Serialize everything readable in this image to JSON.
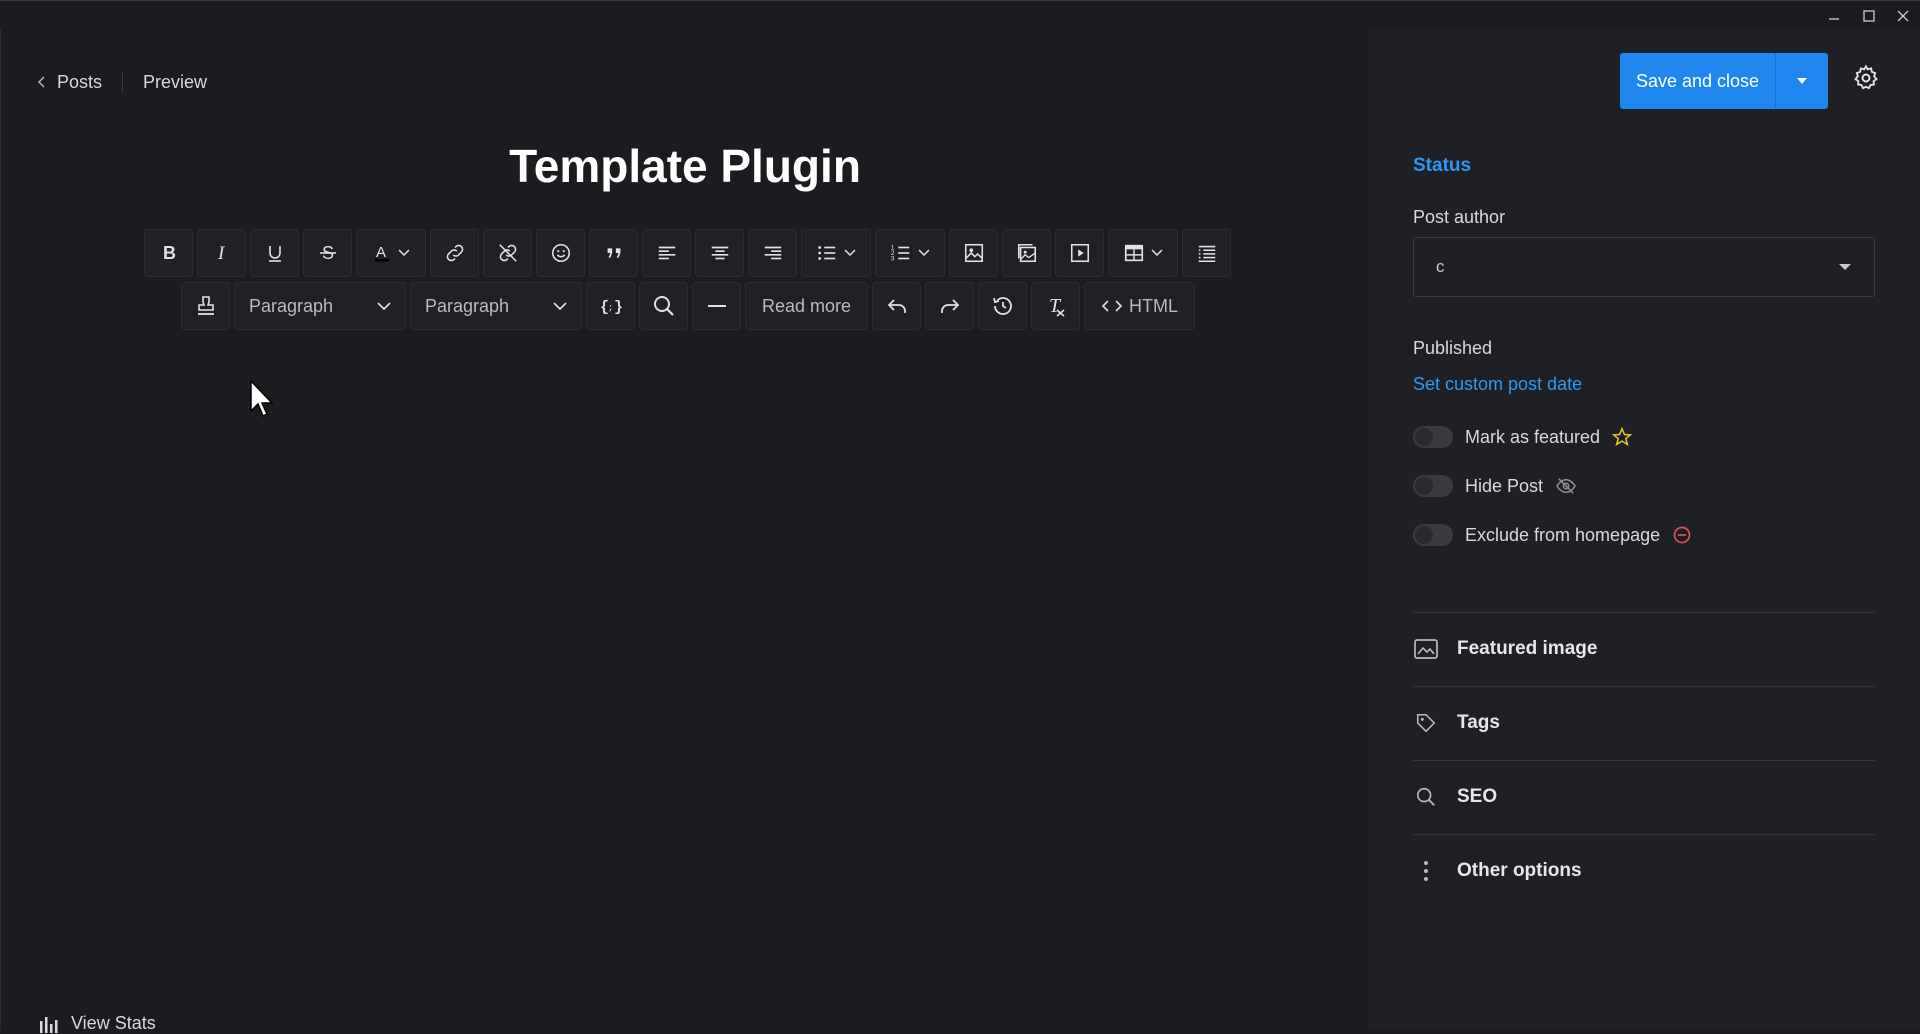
{
  "window": {
    "minimize": "minimize",
    "maximize": "maximize",
    "close": "close"
  },
  "breadcrumb": {
    "back_label": "Posts",
    "preview_label": "Preview"
  },
  "post": {
    "title": "Template Plugin"
  },
  "toolbar": {
    "row1": [
      {
        "name": "bold-button",
        "icon": "bold-icon"
      },
      {
        "name": "italic-button",
        "icon": "italic-icon"
      },
      {
        "name": "underline-button",
        "icon": "underline-icon"
      },
      {
        "name": "strikethrough-button",
        "icon": "strikethrough-icon"
      },
      {
        "name": "text-color-button",
        "icon": "text-color-icon"
      },
      {
        "name": "link-button",
        "icon": "link-icon"
      },
      {
        "name": "unlink-button",
        "icon": "unlink-icon"
      },
      {
        "name": "emoji-button",
        "icon": "emoji-icon"
      },
      {
        "name": "blockquote-button",
        "icon": "quote-icon"
      },
      {
        "name": "align-left-button",
        "icon": "align-left-icon"
      },
      {
        "name": "align-center-button",
        "icon": "align-center-icon"
      },
      {
        "name": "align-right-button",
        "icon": "align-right-icon"
      },
      {
        "name": "bullet-list-button",
        "icon": "bullet-list-icon"
      },
      {
        "name": "numbered-list-button",
        "icon": "numbered-list-icon"
      },
      {
        "name": "image-button",
        "icon": "image-icon"
      },
      {
        "name": "gallery-button",
        "icon": "gallery-icon"
      },
      {
        "name": "media-button",
        "icon": "media-icon"
      },
      {
        "name": "table-button",
        "icon": "table-icon"
      },
      {
        "name": "toc-button",
        "icon": "toc-icon"
      }
    ],
    "row2": {
      "stamp_icon": "stamp-icon",
      "format_select_1": "Paragraph",
      "format_select_2": "Paragraph",
      "code_icon": "code-braces-icon",
      "search_icon": "search-icon",
      "hr_icon": "horizontal-rule-icon",
      "read_more": "Read more",
      "undo_icon": "undo-icon",
      "redo_icon": "redo-icon",
      "history_icon": "history-icon",
      "clear_format_icon": "clear-format-icon",
      "html_label": "HTML"
    }
  },
  "footer": {
    "view_stats": "View Stats"
  },
  "sidebar": {
    "save_label": "Save and close",
    "status_heading": "Status",
    "post_author_label": "Post author",
    "post_author_value": "c",
    "published_label": "Published",
    "custom_date_link": "Set custom post date",
    "toggles": {
      "featured": "Mark as featured",
      "hide": "Hide Post",
      "exclude": "Exclude from homepage"
    },
    "sections": {
      "featured_image": "Featured image",
      "tags": "Tags",
      "seo": "SEO",
      "other": "Other options"
    }
  },
  "colors": {
    "accent": "#1f86f0",
    "link": "#2e97f5",
    "star": "#e6c72a",
    "exclude": "#e05252",
    "background": "#1b1c20",
    "sidebar": "#1f2025"
  }
}
